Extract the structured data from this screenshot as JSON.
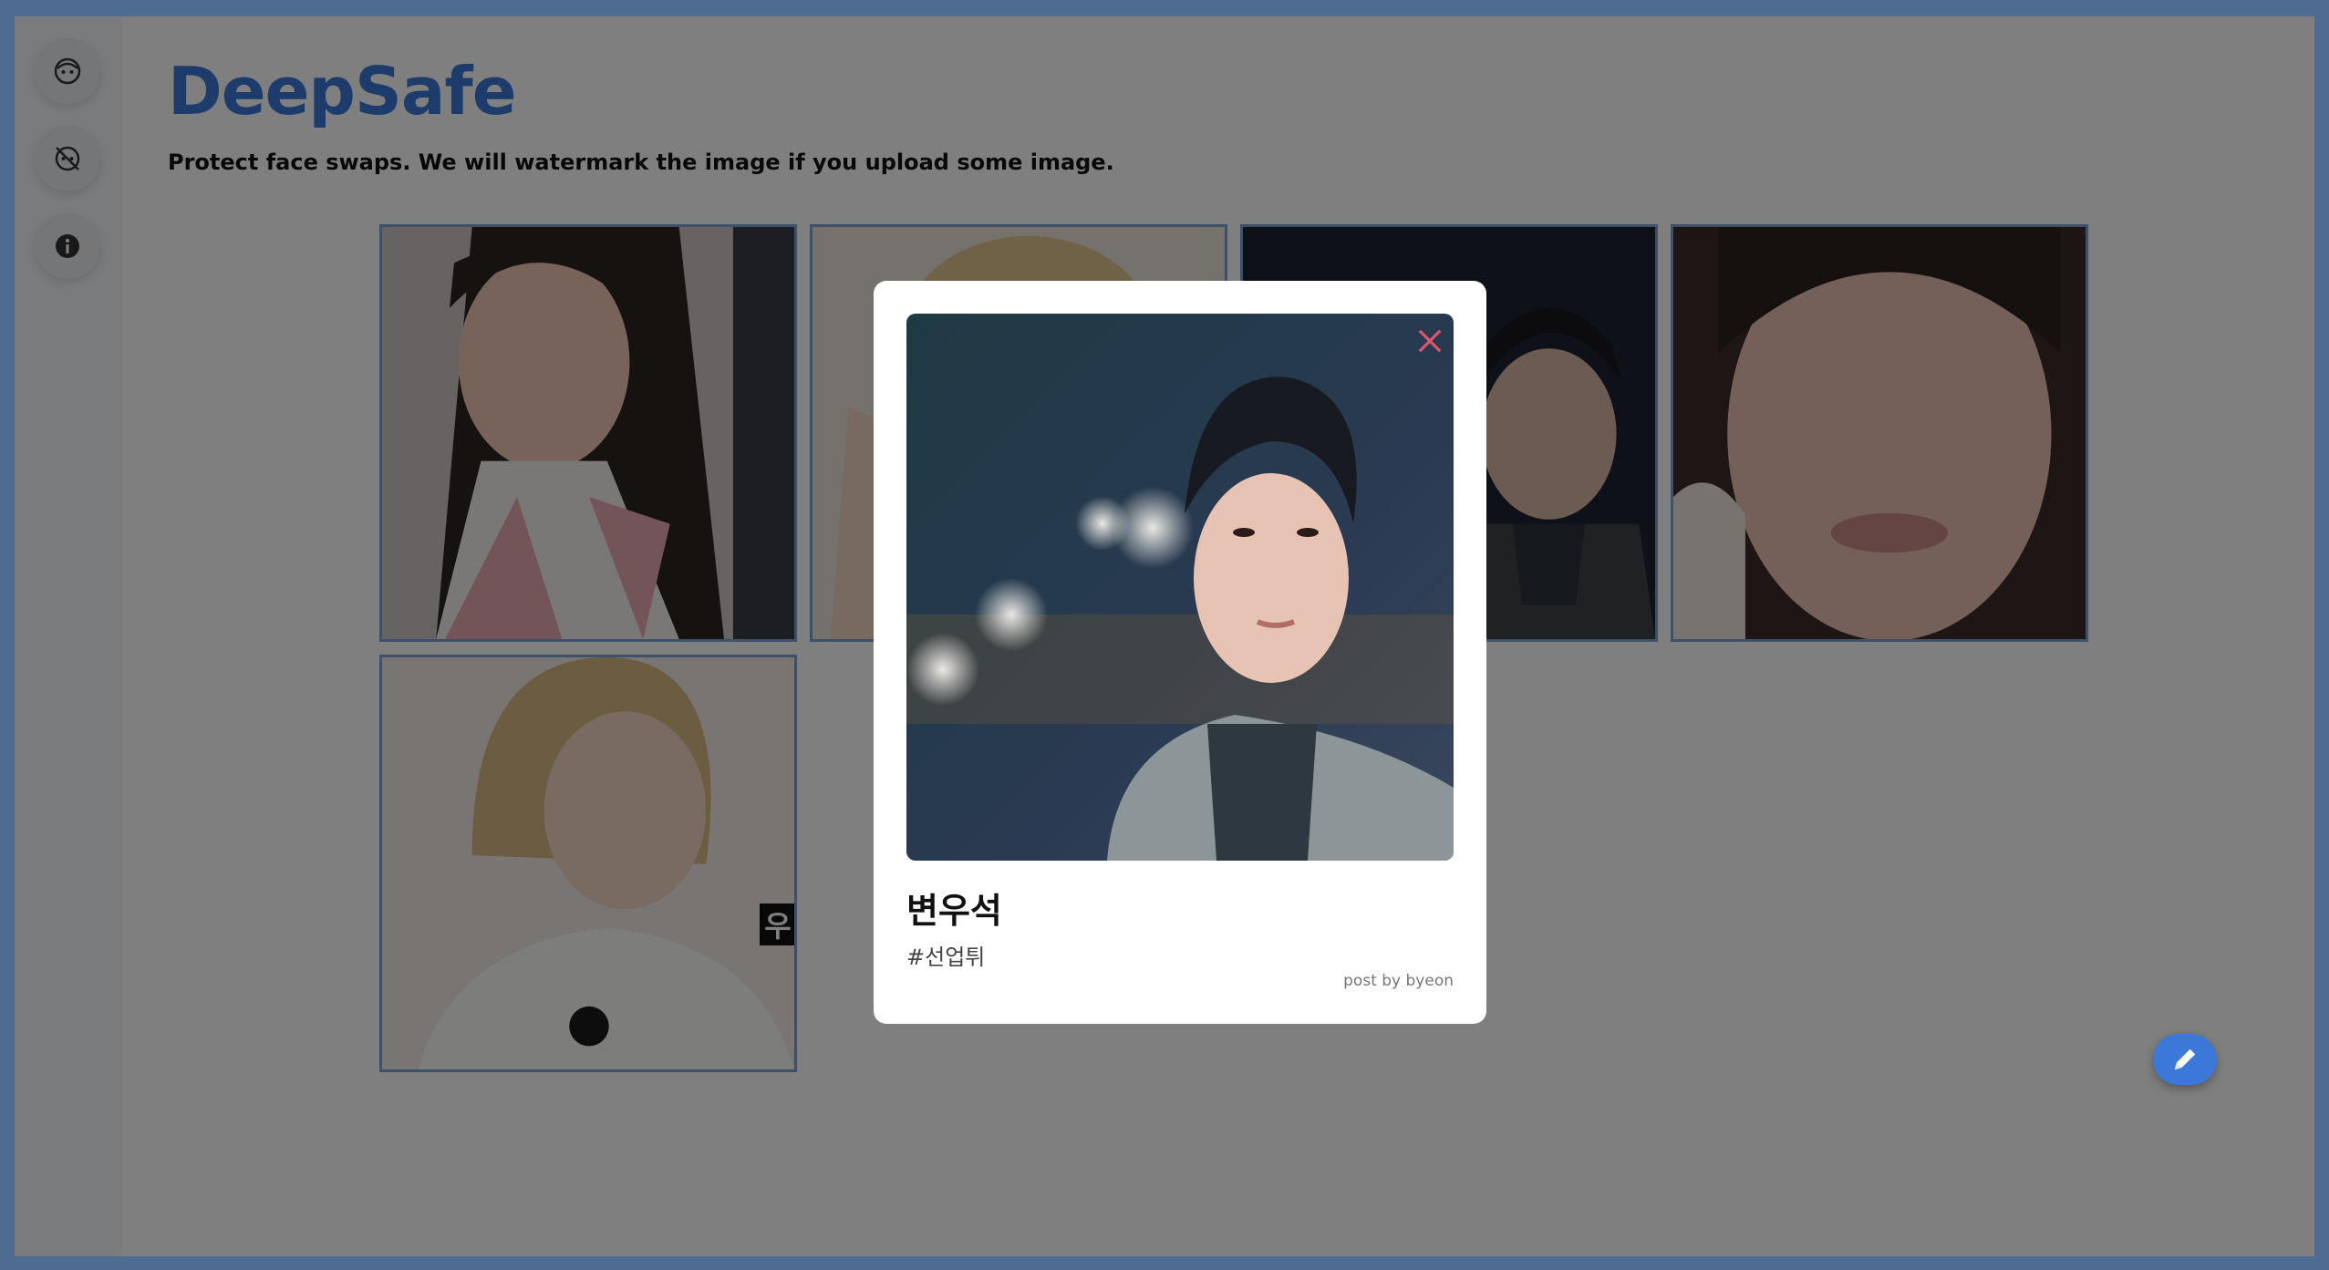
{
  "sidebar": {
    "items": [
      {
        "icon": "face-icon"
      },
      {
        "icon": "face-hidden-icon"
      },
      {
        "icon": "info-icon"
      }
    ]
  },
  "header": {
    "brand": "DeepSafe",
    "tagline": "Protect face swaps. We will watermark the image if you upload some image."
  },
  "gallery": {
    "cards": [
      {
        "palette": "pink-vest"
      },
      {
        "palette": "blonde-wave"
      },
      {
        "palette": "dark-coat"
      },
      {
        "palette": "fur-collar"
      },
      {
        "palette": "blonde-bob",
        "watermark": "우"
      }
    ]
  },
  "modal": {
    "title": "변우석",
    "tag": "#선업튀",
    "author": "post by byeon",
    "close_color": "#e0556b"
  },
  "fab": {
    "icon": "pencil-icon"
  },
  "colors": {
    "accent": "#3b78d8",
    "frame": "#4e6b91",
    "card_border": "#7ea0d2"
  }
}
